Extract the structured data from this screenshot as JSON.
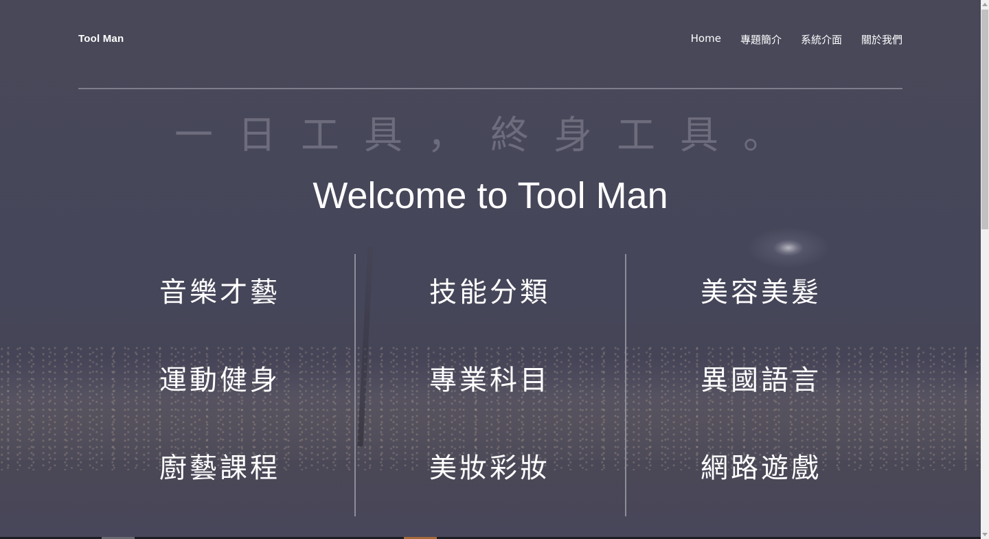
{
  "header": {
    "brand": "Tool Man",
    "nav": [
      "Home",
      "專題簡介",
      "系統介面",
      "關於我們"
    ]
  },
  "hero": {
    "slogan": "一日工具，終身工具。",
    "title": "Welcome to Tool Man"
  },
  "categories": {
    "col1": [
      "音樂才藝",
      "運動健身",
      "廚藝課程"
    ],
    "col2": [
      "技能分類",
      "專業科目",
      "美妝彩妝"
    ],
    "col3": [
      "美容美髮",
      "異國語言",
      "網路遊戲"
    ]
  },
  "colors": {
    "overlay": "#454559",
    "text": "#ffffff",
    "rule": "#7d7d8c"
  }
}
